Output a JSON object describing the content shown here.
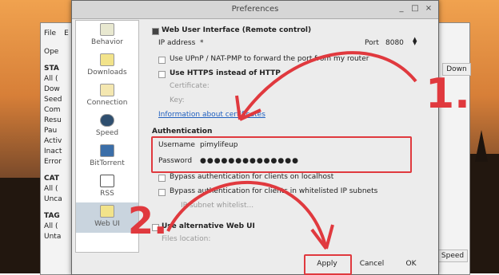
{
  "window_title": "Preferences",
  "titlebar_buttons": [
    "_",
    "□",
    "×"
  ],
  "background_app": {
    "menu": [
      "File",
      "E"
    ],
    "left_items": [
      "Ope",
      "STA",
      "All (",
      "Dow",
      "Seed",
      "Com",
      "Resu",
      "Pau",
      "Activ",
      "Inact",
      "Error",
      "CAT",
      "All (",
      "Unca",
      "TAG",
      "All (",
      "Unta"
    ],
    "column_header": "Down",
    "status": "Speed"
  },
  "categories": [
    {
      "label": "Behavior",
      "icon": "behavior-icon"
    },
    {
      "label": "Downloads",
      "icon": "downloads-icon"
    },
    {
      "label": "Connection",
      "icon": "connection-icon"
    },
    {
      "label": "Speed",
      "icon": "speed-icon"
    },
    {
      "label": "BitTorrent",
      "icon": "bittorrent-icon"
    },
    {
      "label": "RSS",
      "icon": "rss-icon"
    },
    {
      "label": "Web UI",
      "icon": "webui-icon"
    }
  ],
  "webui": {
    "section_title": "Web User Interface (Remote control)",
    "ip_label": "IP address",
    "ip_value": "*",
    "port_label": "Port",
    "port_value": "8080",
    "upnp_label": "Use UPnP / NAT-PMP to forward the port from my router",
    "https_label": "Use HTTPS instead of HTTP",
    "certificate_label": "Certificate:",
    "key_label": "Key:",
    "info_link": "Information about certificates",
    "auth_title": "Authentication",
    "username_label": "Username",
    "username_value": "pimylifeup",
    "password_label": "Password",
    "password_value": "●●●●●●●●●●●●●●",
    "bypass_localhost": "Bypass authentication for clients on localhost",
    "bypass_whitelist": "Bypass authentication for clients in whitelisted IP subnets",
    "whitelist_placeholder": "IP subnet whitelist...",
    "alt_webui_title": "Use alternative Web UI",
    "files_location_label": "Files location:"
  },
  "buttons": {
    "apply": "Apply",
    "cancel": "Cancel",
    "ok": "OK"
  },
  "annotations": {
    "step1": "1.",
    "step2": "2."
  },
  "colors": {
    "annotation": "#e0393e",
    "link": "#1f5fbf",
    "selected": "#c9d4de"
  }
}
